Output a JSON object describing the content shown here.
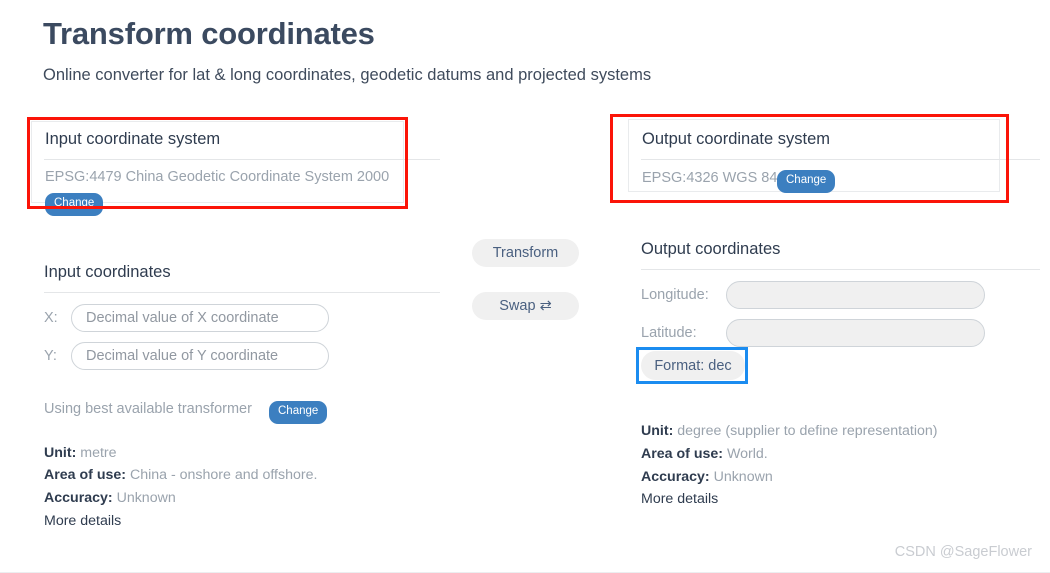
{
  "header": {
    "title": "Transform coordinates",
    "subtitle": "Online converter for lat & long coordinates, geodetic datums and projected systems"
  },
  "input_system": {
    "heading": "Input coordinate system",
    "epsg": "EPSG:4479 China Geodetic Coordinate System 2000",
    "change_label": "Change"
  },
  "output_system": {
    "heading": "Output coordinate system",
    "epsg": "EPSG:4326 WGS 84",
    "change_label": "Change"
  },
  "input_coordinates": {
    "heading": "Input coordinates",
    "x_label": "X:",
    "x_value": "",
    "x_placeholder": "Decimal value of X coordinate",
    "y_label": "Y:",
    "y_value": "",
    "y_placeholder": "Decimal value of Y coordinate"
  },
  "actions": {
    "transform_label": "Transform",
    "swap_label": "Swap ⇄"
  },
  "output_coordinates": {
    "heading": "Output coordinates",
    "longitude_label": "Longitude:",
    "longitude_value": "",
    "latitude_label": "Latitude:",
    "latitude_value": "",
    "format_label": "Format: dec"
  },
  "input_meta": {
    "transformer_note": "Using best available transformer",
    "transformer_change_label": "Change",
    "unit_label": "Unit:",
    "unit_value": "metre",
    "area_label": "Area of use:",
    "area_value": "China - onshore and offshore.",
    "accuracy_label": "Accuracy:",
    "accuracy_value": "Unknown",
    "more_details": "More details"
  },
  "output_meta": {
    "unit_label": "Unit:",
    "unit_value": "degree (supplier to define representation)",
    "area_label": "Area of use:",
    "area_value": "World.",
    "accuracy_label": "Accuracy:",
    "accuracy_value": "Unknown",
    "more_details": "More details"
  },
  "watermark": "CSDN @SageFlower",
  "colors": {
    "title": "#3b4a60",
    "badge_blue": "#3c7fc0",
    "annotation_red": "#fb1408",
    "annotation_blue": "#1b8cf0",
    "muted_text": "#9aa3ad"
  }
}
